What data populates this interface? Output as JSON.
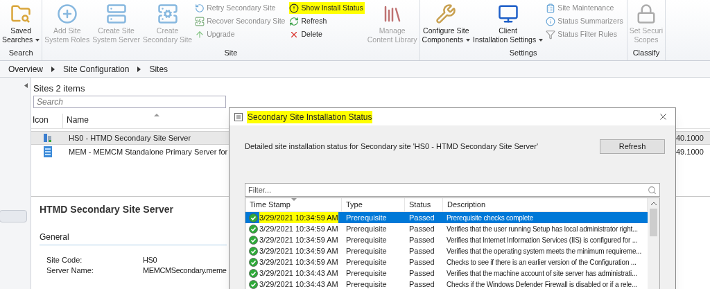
{
  "ribbon": {
    "groups": [
      {
        "label": "Search",
        "columns": [
          {
            "kind": "large",
            "label": "Saved\nSearches",
            "dropdown": true,
            "disabled": false
          }
        ]
      },
      {
        "label": "Site",
        "columns": [
          {
            "kind": "large",
            "label": "Add Site\nSystem Roles",
            "dropdown": false,
            "disabled": true
          },
          {
            "kind": "large",
            "label": "Create Site\nSystem Server",
            "dropdown": false,
            "disabled": true
          },
          {
            "kind": "large",
            "label": "Create\nSecondary Site",
            "dropdown": false,
            "disabled": true
          },
          {
            "kind": "stack",
            "items": [
              {
                "label": "Retry Secondary Site",
                "disabled": true,
                "highlighted": false
              },
              {
                "label": "Recover Secondary Site",
                "disabled": true,
                "highlighted": false
              },
              {
                "label": "Upgrade",
                "disabled": true,
                "highlighted": false
              }
            ]
          },
          {
            "kind": "stack",
            "items": [
              {
                "label": "Show Install Status",
                "disabled": false,
                "highlighted": true
              },
              {
                "label": "Refresh",
                "disabled": false,
                "highlighted": false
              },
              {
                "label": "Delete",
                "disabled": false,
                "highlighted": false
              }
            ]
          },
          {
            "kind": "large",
            "label": "Manage\nContent Library",
            "dropdown": false,
            "disabled": true
          }
        ]
      },
      {
        "label": "Settings",
        "columns": [
          {
            "kind": "large",
            "label": "Configure Site\nComponents",
            "dropdown": true,
            "disabled": false
          },
          {
            "kind": "large",
            "label": "Client\nInstallation Settings",
            "dropdown": true,
            "disabled": false
          },
          {
            "kind": "stack",
            "items": [
              {
                "label": "Site Maintenance",
                "disabled": true,
                "highlighted": false
              },
              {
                "label": "Status Summarizers",
                "disabled": true,
                "highlighted": false
              },
              {
                "label": "Status Filter Rules",
                "disabled": true,
                "highlighted": false
              }
            ]
          }
        ]
      },
      {
        "label": "Classify",
        "columns": [
          {
            "kind": "large",
            "label": "Set Securi\nScopes",
            "dropdown": false,
            "disabled": true
          }
        ]
      }
    ]
  },
  "breadcrumb": [
    "Overview",
    "Site Configuration",
    "Sites"
  ],
  "sites": {
    "title": "Sites 2 items",
    "search": {
      "placeholder": "Search"
    },
    "columns": [
      "Icon",
      "Name"
    ],
    "rows": [
      {
        "kind": "secondary",
        "name": "HS0 - HTMD Secondary Site Server",
        "column_3": "40.1000",
        "selected": true
      },
      {
        "kind": "primary",
        "name": "MEM - MEMCM Standalone Primary Server for",
        "column_3": "49.1000",
        "selected": false
      }
    ]
  },
  "details": {
    "title": "HTMD Secondary Site Server",
    "section": "General",
    "fields": [
      {
        "label": "Site Code:",
        "value": "HS0"
      },
      {
        "label": "Server Name:",
        "value": "MEMCMSecondary.meme"
      }
    ]
  },
  "dialog": {
    "title": "Secondary Site Installation Status",
    "title_highlighted": true,
    "description": "Detailed site installation status for Secondary site 'HS0 - HTMD Secondary Site Server'",
    "refresh": "Refresh",
    "filter": {
      "placeholder": "Filter..."
    },
    "columns": [
      "Time Stamp",
      "Type",
      "Status",
      "Description"
    ],
    "rows": [
      {
        "time": "3/29/2021 10:34:59 AM",
        "type": "Prerequisite",
        "status": "Passed",
        "description": "Prerequisite checks complete",
        "selected": true,
        "highlighted": true
      },
      {
        "time": "3/29/2021 10:34:59 AM",
        "type": "Prerequisite",
        "status": "Passed",
        "description": "Verifies that the user running Setup has local administrator right...",
        "selected": false,
        "highlighted": false
      },
      {
        "time": "3/29/2021 10:34:59 AM",
        "type": "Prerequisite",
        "status": "Passed",
        "description": "Verifies that Internet Information Services (IIS) is configured for ...",
        "selected": false,
        "highlighted": false
      },
      {
        "time": "3/29/2021 10:34:59 AM",
        "type": "Prerequisite",
        "status": "Passed",
        "description": "Verifies that the operating system meets the minimum requireme...",
        "selected": false,
        "highlighted": false
      },
      {
        "time": "3/29/2021 10:34:59 AM",
        "type": "Prerequisite",
        "status": "Passed",
        "description": "Checks to see if there is an earlier version of the Configuration ...",
        "selected": false,
        "highlighted": false
      },
      {
        "time": "3/29/2021 10:34:43 AM",
        "type": "Prerequisite",
        "status": "Passed",
        "description": "Verifies that the machine account of site server has administrati...",
        "selected": false,
        "highlighted": false
      },
      {
        "time": "3/29/2021 10:34:43 AM",
        "type": "Prerequisite",
        "status": "Passed",
        "description": "Checks if the Windows Defender Firewall is disabled or if a rele...",
        "selected": false,
        "highlighted": false
      }
    ]
  }
}
